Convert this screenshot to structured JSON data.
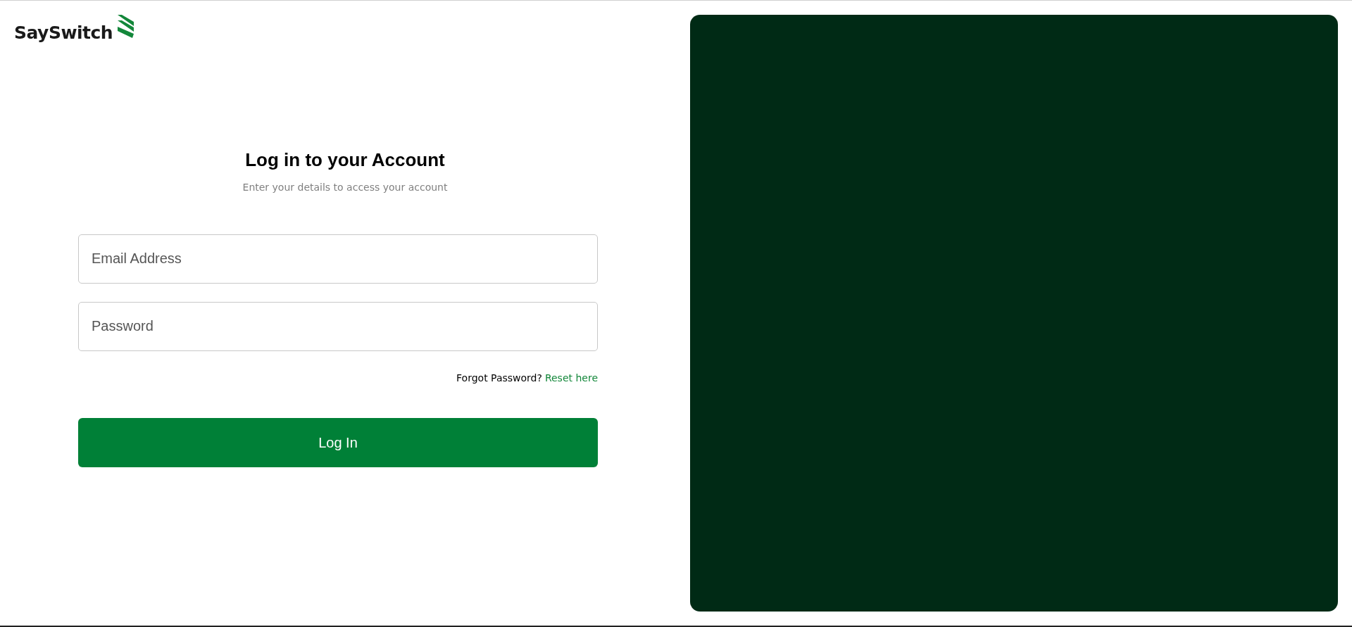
{
  "logo": {
    "text": "SaySwitch"
  },
  "login": {
    "title": "Log in to your Account",
    "subtitle": "Enter your details to access your account",
    "fields": [
      {
        "placeholder": "Email Address"
      },
      {
        "placeholder": "Password"
      }
    ],
    "forgot": {
      "text": "Forgot Password?",
      "link": "Reset here"
    },
    "button": "Log In"
  }
}
